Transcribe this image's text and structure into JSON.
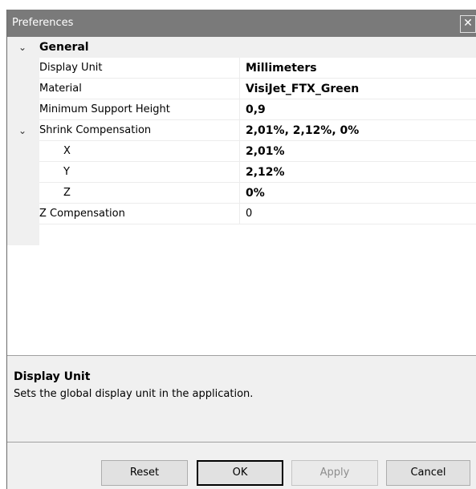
{
  "window": {
    "title": "Preferences",
    "close_glyph": "✕"
  },
  "grid": {
    "category": "General",
    "rows": [
      {
        "name": "Display Unit",
        "value": "Millimeters"
      },
      {
        "name": "Material",
        "value": "VisiJet_FTX_Green"
      },
      {
        "name": "Minimum Support Height",
        "value": "0,9"
      },
      {
        "name": "Shrink Compensation",
        "value": "2,01%, 2,12%, 0%"
      },
      {
        "name": "X",
        "value": "2,01%"
      },
      {
        "name": "Y",
        "value": "2,12%"
      },
      {
        "name": "Z",
        "value": "0%"
      },
      {
        "name": "Z Compensation",
        "value": "0"
      }
    ],
    "chevron_glyph": "⌄"
  },
  "description": {
    "title": "Display Unit",
    "text": "Sets the global display unit in the application."
  },
  "buttons": {
    "reset": "Reset",
    "ok": "OK",
    "apply": "Apply",
    "cancel": "Cancel"
  }
}
